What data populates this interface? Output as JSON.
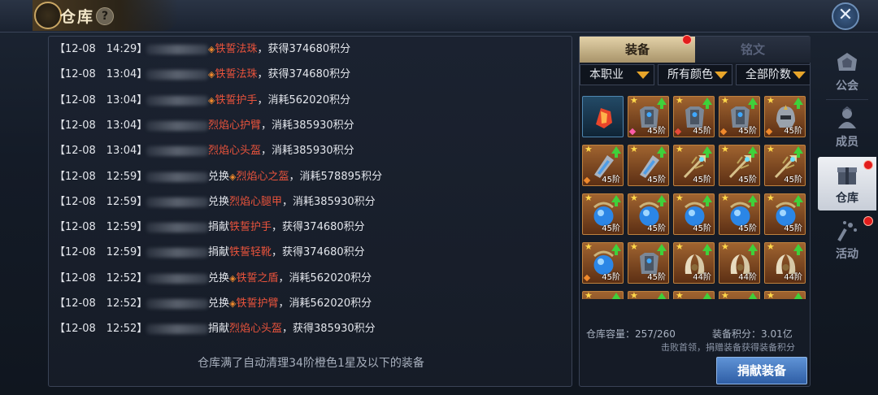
{
  "window": {
    "title": "仓库",
    "help_icon": "?",
    "close_icon": "✕"
  },
  "log": {
    "rows": [
      {
        "time": "【12-08　14:29】",
        "verb": "",
        "diamond": "◈",
        "item": "铁誓法珠",
        "rest": "，获得374680积分"
      },
      {
        "time": "【12-08　13:04】",
        "verb": "",
        "diamond": "◈",
        "item": "铁誓法珠",
        "rest": "，获得374680积分"
      },
      {
        "time": "【12-08　13:04】",
        "verb": "",
        "diamond": "◈",
        "item": "铁誓护手",
        "rest": "，消耗562020积分"
      },
      {
        "time": "【12-08　13:04】",
        "verb": "",
        "diamond": "",
        "item": "烈焰心护臂",
        "rest": "，消耗385930积分"
      },
      {
        "time": "【12-08　13:04】",
        "verb": "",
        "diamond": "",
        "item": "烈焰心头盔",
        "rest": "，消耗385930积分"
      },
      {
        "time": "【12-08　12:59】",
        "verb": "兑换",
        "diamond": "◈",
        "item": "烈焰心之盔",
        "rest": "，消耗578895积分"
      },
      {
        "time": "【12-08　12:59】",
        "verb": "兑换",
        "diamond": "",
        "item": "烈焰心腿甲",
        "rest": "，消耗385930积分"
      },
      {
        "time": "【12-08　12:59】",
        "verb": "捐献",
        "diamond": "",
        "item": "铁誓护手",
        "rest": "，获得374680积分"
      },
      {
        "time": "【12-08　12:59】",
        "verb": "捐献",
        "diamond": "",
        "item": "铁誓轻靴",
        "rest": "，获得374680积分"
      },
      {
        "time": "【12-08　12:52】",
        "verb": "兑换",
        "diamond": "◈",
        "item": "铁誓之盾",
        "rest": "，消耗562020积分"
      },
      {
        "time": "【12-08　12:52】",
        "verb": "兑换",
        "diamond": "◈",
        "item": "铁誓护臂",
        "rest": "，消耗562020积分"
      },
      {
        "time": "【12-08　12:52】",
        "verb": "捐献",
        "diamond": "",
        "item": "烈焰心头盔",
        "rest": "，获得385930积分"
      }
    ],
    "footer": "仓库满了自动清理34阶橙色1星及以下的装备"
  },
  "warehouse": {
    "tabs": [
      {
        "label": "装备",
        "active": true
      },
      {
        "label": "铭文",
        "active": false
      }
    ],
    "filters": [
      {
        "label": "本职业"
      },
      {
        "label": "所有颜色"
      },
      {
        "label": "全部阶数"
      }
    ],
    "slots": [
      {
        "kind": "flame-gem",
        "color": "blue",
        "star": false,
        "up": false,
        "level": ""
      },
      {
        "kind": "armor",
        "color": "orange",
        "star": true,
        "up": true,
        "level": "45阶",
        "gem": "#ff5ca8"
      },
      {
        "kind": "armor",
        "color": "orange",
        "star": true,
        "up": true,
        "level": "45阶",
        "gem": "#e84a3a"
      },
      {
        "kind": "armor",
        "color": "orange",
        "star": true,
        "up": true,
        "level": "45阶",
        "gem": "#f08a2c"
      },
      {
        "kind": "helmet",
        "color": "orange",
        "star": true,
        "up": true,
        "level": "45阶",
        "gem": "#f08a2c"
      },
      {
        "kind": "bracer",
        "color": "orange",
        "star": true,
        "up": true,
        "level": "45阶",
        "gem": "#f08a2c"
      },
      {
        "kind": "bracer",
        "color": "orange",
        "star": true,
        "up": true,
        "level": "45阶",
        "gem": ""
      },
      {
        "kind": "staff",
        "color": "orange",
        "star": true,
        "up": true,
        "level": "45阶",
        "gem": ""
      },
      {
        "kind": "staff",
        "color": "orange",
        "star": true,
        "up": true,
        "level": "45阶",
        "gem": ""
      },
      {
        "kind": "staff",
        "color": "orange",
        "star": true,
        "up": true,
        "level": "45阶",
        "gem": ""
      },
      {
        "kind": "orb",
        "color": "orange",
        "star": true,
        "up": true,
        "level": "45阶",
        "gem": ""
      },
      {
        "kind": "orb",
        "color": "orange",
        "star": true,
        "up": true,
        "level": "45阶",
        "gem": ""
      },
      {
        "kind": "orb",
        "color": "orange",
        "star": true,
        "up": true,
        "level": "45阶",
        "gem": ""
      },
      {
        "kind": "orb",
        "color": "orange",
        "star": true,
        "up": true,
        "level": "45阶",
        "gem": ""
      },
      {
        "kind": "orb",
        "color": "orange",
        "star": true,
        "up": true,
        "level": "45阶",
        "gem": ""
      },
      {
        "kind": "orb",
        "color": "orange",
        "star": true,
        "up": true,
        "level": "45阶",
        "gem": "#f08a2c"
      },
      {
        "kind": "armor",
        "color": "orange",
        "star": true,
        "up": true,
        "level": "45阶",
        "gem": ""
      },
      {
        "kind": "horn",
        "color": "orange",
        "star": true,
        "up": true,
        "level": "44阶",
        "gem": ""
      },
      {
        "kind": "horn",
        "color": "orange",
        "star": true,
        "up": true,
        "level": "44阶",
        "gem": ""
      },
      {
        "kind": "horn",
        "color": "orange",
        "star": true,
        "up": true,
        "level": "44阶",
        "gem": ""
      },
      {
        "kind": "horn",
        "color": "orange",
        "star": true,
        "up": true,
        "level": "",
        "gem": ""
      },
      {
        "kind": "horn",
        "color": "orange",
        "star": true,
        "up": true,
        "level": "",
        "gem": ""
      },
      {
        "kind": "horn",
        "color": "orange",
        "star": true,
        "up": true,
        "level": "",
        "gem": ""
      },
      {
        "kind": "horn",
        "color": "orange",
        "star": true,
        "up": true,
        "level": "",
        "gem": ""
      },
      {
        "kind": "horn",
        "color": "orange",
        "star": true,
        "up": true,
        "level": "",
        "gem": ""
      }
    ],
    "capacity": "仓库容量：257/260",
    "points": "装备积分：3.01亿",
    "note": "击败首领，捐赠装备获得装备积分",
    "donate_button": "捐献装备"
  },
  "side_nav": [
    {
      "label": "公会",
      "icon": "guild-icon",
      "active": false,
      "badge": false
    },
    {
      "label": "成员",
      "icon": "members-icon",
      "active": false,
      "badge": false
    },
    {
      "label": "仓库",
      "icon": "warehouse-icon",
      "active": true,
      "badge": true
    },
    {
      "label": "活动",
      "icon": "activity-icon",
      "active": false,
      "badge": true
    }
  ]
}
